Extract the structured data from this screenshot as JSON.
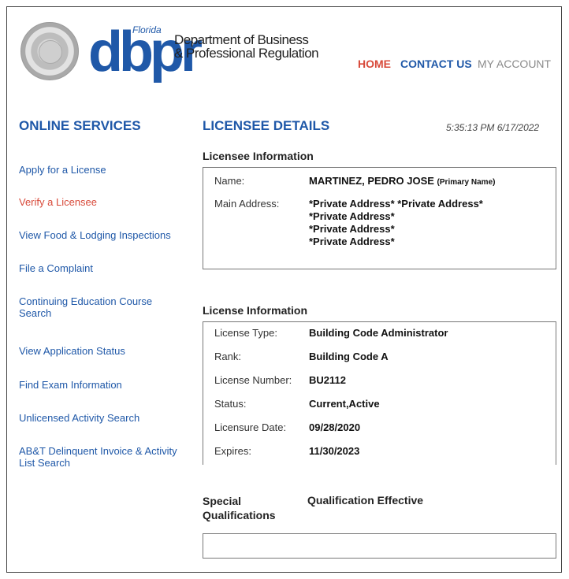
{
  "header": {
    "logo_text": "dbpr",
    "logo_state": "Florida",
    "department_line1": "Department of Business",
    "department_line2": "& Professional Regulation",
    "nav": {
      "home": "HOME",
      "contact_us": "CONTACT US",
      "my_account": "MY ACCOUNT"
    },
    "colors": {
      "brand_blue": "#1f58a8",
      "accent_red": "#d84a3a",
      "muted_gray": "#8a8a8a"
    }
  },
  "sidebar": {
    "title": "ONLINE SERVICES",
    "items": [
      {
        "label": "Apply for a License"
      },
      {
        "label": "Verify a Licensee",
        "active": true
      },
      {
        "label": "View Food & Lodging Inspections"
      },
      {
        "label": "File a Complaint"
      },
      {
        "label": "Continuing Education Course Search"
      },
      {
        "label": "View Application Status"
      },
      {
        "label": "Find Exam Information"
      },
      {
        "label": "Unlicensed Activity Search"
      },
      {
        "label": "AB&T Delinquent Invoice & Activity List Search"
      }
    ]
  },
  "main": {
    "title": "LICENSEE DETAILS",
    "timestamp": "5:35:13 PM 6/17/2022",
    "licensee_info": {
      "section_title": "Licensee Information",
      "name_label": "Name:",
      "name_value": "MARTINEZ, PEDRO JOSE",
      "name_note": "(Primary Name)",
      "address_label": "Main Address:",
      "address_lines": [
        "*Private Address* *Private Address*",
        "*Private Address*",
        "*Private Address*",
        "*Private Address*"
      ]
    },
    "license_info": {
      "section_title": "License Information",
      "rows": [
        {
          "label": "License Type:",
          "value": "Building Code Administrator"
        },
        {
          "label": "Rank:",
          "value": "Building Code A"
        },
        {
          "label": "License Number:",
          "value": "BU2112"
        },
        {
          "label": "Status:",
          "value": "Current,Active"
        },
        {
          "label": "Licensure Date:",
          "value": "09/28/2020"
        },
        {
          "label": "Expires:",
          "value": "11/30/2023"
        }
      ]
    },
    "special_qualifications": {
      "title_line1": "Special",
      "title_line2": "Qualifications",
      "effective_header": "Qualification Effective"
    }
  }
}
